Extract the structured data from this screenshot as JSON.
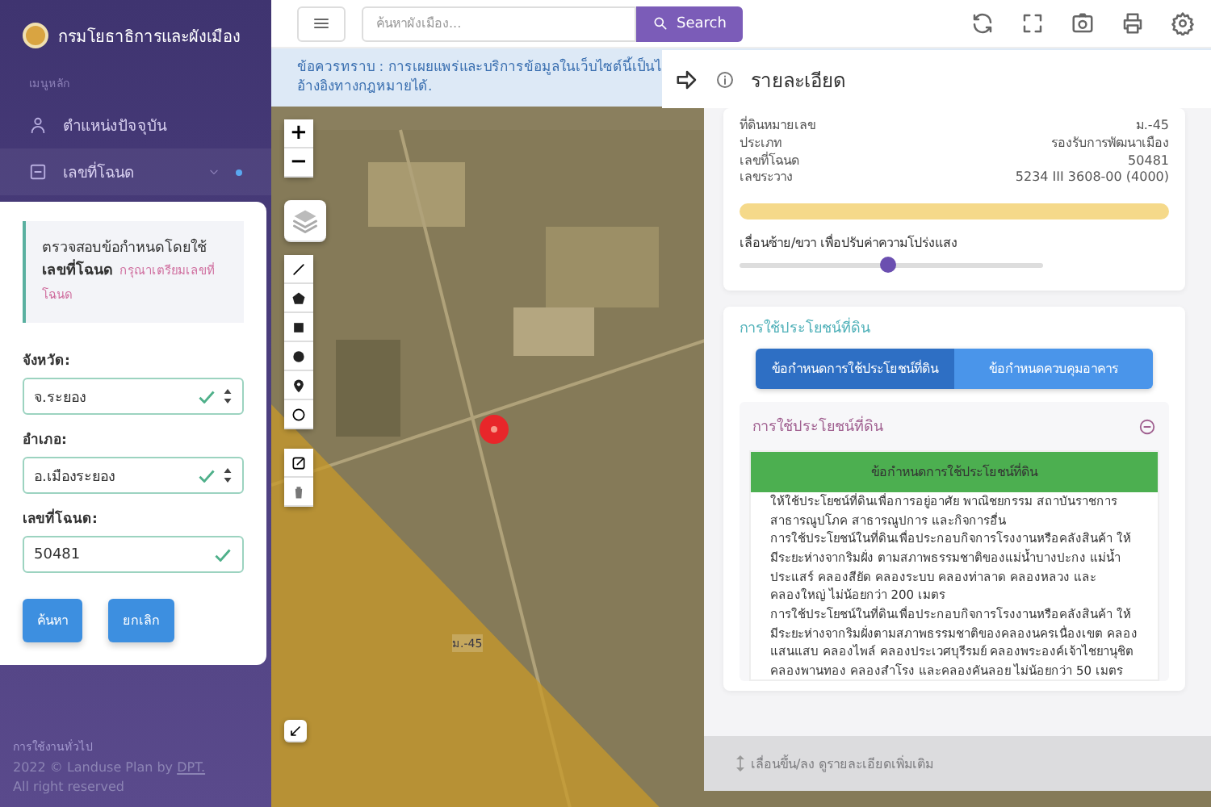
{
  "sidebar": {
    "title": "กรมโยธาธิการและผังเมือง",
    "section": "เมนูหลัก",
    "items": [
      {
        "label": "ตำแหน่งปัจจุบัน",
        "expanded": false
      },
      {
        "label": "เลขที่โฉนด",
        "expanded": true
      }
    ],
    "form": {
      "intro": "ตรวจสอบข้อกำหนดโดยใช้ **เลขที่โฉนด**",
      "hint": "กรุณาเตรียมเลขที่โฉนด",
      "fields": [
        {
          "kind": "select",
          "label": "จังหวัด:",
          "value": "จ.ระยอง",
          "valid": true
        },
        {
          "kind": "select",
          "label": "อำเภอ:",
          "value": "อ.เมืองระยอง",
          "valid": true
        },
        {
          "kind": "input",
          "label": "เลขที่โฉนด:",
          "value": "50481",
          "valid": true
        }
      ],
      "buttons": [
        "ค้นหา",
        "ยกเลิก"
      ]
    },
    "footer_section": "การใช้งานทั่วไป",
    "copyright": "2022 © Landuse Plan by",
    "copyright_link": "DPT.",
    "rights": "All right reserved"
  },
  "topbar": {
    "search": {
      "placeholder": "ค้นหาผังเมือง..."
    },
    "search_button": "Search"
  },
  "notice": "ข้อควรทราบ : การเผยแพร่และบริการข้อมูลในเว็บไซต์นี้เป็นไ อ้างอิงทางกฎหมายได้.",
  "map": {
    "label": "ม.-45",
    "zoom_in": "+",
    "zoom_out": "−"
  },
  "detail": {
    "title": "รายละเอียด",
    "rows": [
      {
        "key": "ที่ดินหมายเลข",
        "value": "ม.-45"
      },
      {
        "key": "ประเภท",
        "value": "รองรับการพัฒนาเมือง"
      },
      {
        "key": "เลขที่โฉนด",
        "value": "50481"
      },
      {
        "key": "เลขระวาง",
        "value": "5234 III 3608-00 (4000)"
      }
    ],
    "opacity": {
      "label": "เลื่อนซ้าย/ขวา เพื่อปรับค่าความโปร่งแสง",
      "level": 0.49
    },
    "landuse": {
      "title": "การใช้ประโยชน์ที่ดิน",
      "tabs": [
        {
          "label": "ข้อกำหนดการใช้ประโยชน์ที่ดิน",
          "selected": true
        },
        {
          "label": "ข้อกำหนดควบคุมอาคาร",
          "selected": false
        }
      ],
      "accordion": {
        "title": "การใช้ประโยชน์ที่ดิน",
        "expanded": true,
        "heading": "ข้อกำหนดการใช้ประโยชน์ที่ดิน",
        "paragraphs": [
          "ให้ใช้ประโยชน์ที่ดินเพื่อการอยู่อาศัย พาณิชยกรรม สถาบันราชการ สาธารณูปโภค สาธารณูปการ และกิจการอื่น",
          "การใช้ประโยชน์ในที่ดินเพื่อประกอบกิจการโรงงานหรือคลังสินค้า ให้มีระยะห่างจากริมฝั่ง ตามสภาพธรรมชาติของแม่น้ำบางปะกง แม่น้ำประแสร์ คลองสียัด คลองระบบ คลองท่าลาด คลองหลวง และคลองใหญ่ ไม่น้อยกว่า 200 เมตร",
          "การใช้ประโยชน์ในที่ดินเพื่อประกอบกิจการโรงงานหรือคลังสินค้า ให้มีระยะห่างจากริมฝั่งตามสภาพธรรมชาติของคลองนครเนื่องเขต คลองแสนแสบ คลองไพล์ คลองประเวศบุรีรมย์ คลองพระองค์เจ้าไชยานุชิต คลองพานทอง คลองสำโรง และคลองคันลอย ไม่น้อยกว่า 50 เมตร"
        ]
      }
    },
    "scroll_hint": "เลื่อนขึ้น/ลง ดูรายละเอียดเพิ่มเติม"
  }
}
